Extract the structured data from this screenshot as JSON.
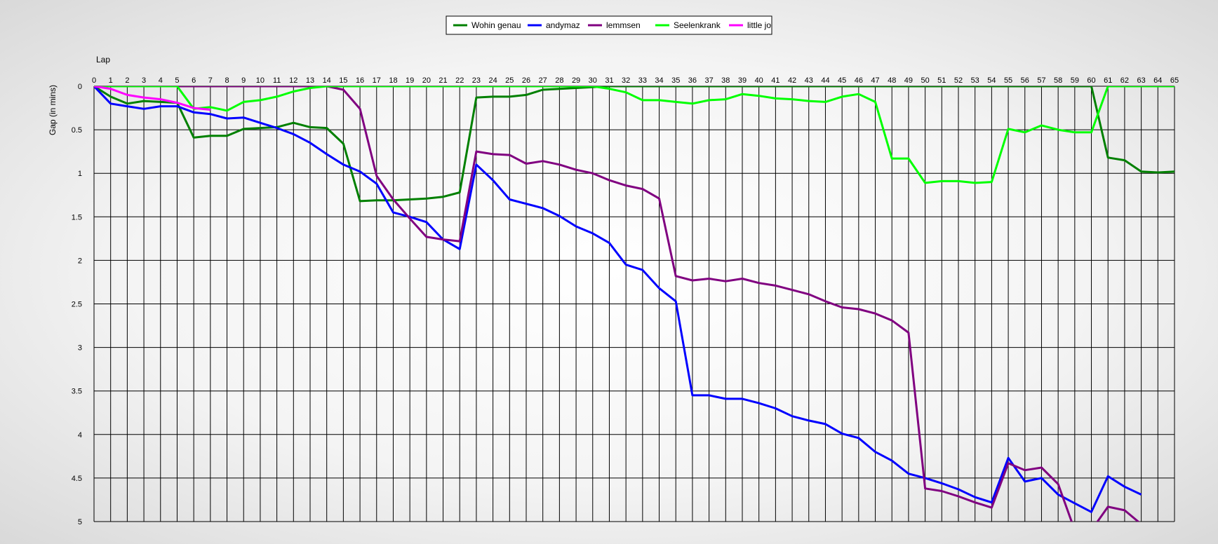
{
  "chart_data": {
    "type": "line",
    "xlabel": "Lap",
    "ylabel": "Gap (in mins)",
    "xlim": [
      0,
      65
    ],
    "ylim": [
      0,
      5
    ],
    "y_reversed": true,
    "x_ticks": [
      0,
      1,
      2,
      3,
      4,
      5,
      6,
      7,
      8,
      9,
      10,
      11,
      12,
      13,
      14,
      15,
      16,
      17,
      18,
      19,
      20,
      21,
      22,
      23,
      24,
      25,
      26,
      27,
      28,
      29,
      30,
      31,
      32,
      33,
      34,
      35,
      36,
      37,
      38,
      39,
      40,
      41,
      42,
      43,
      44,
      45,
      46,
      47,
      48,
      49,
      50,
      51,
      52,
      53,
      54,
      55,
      56,
      57,
      58,
      59,
      60,
      61,
      62,
      63,
      64,
      65
    ],
    "y_ticks": [
      "0",
      "0.5",
      "1",
      "1.5",
      "2",
      "2.5",
      "3",
      "3.5",
      "4",
      "4.5",
      "5"
    ],
    "y_tick_values": [
      0,
      0.5,
      1,
      1.5,
      2,
      2.5,
      3,
      3.5,
      4,
      4.5,
      5
    ],
    "grid": true,
    "legend_position": "top-center",
    "series": [
      {
        "name": "Wohin genau",
        "color": "#008000",
        "x": [
          0,
          1,
          2,
          3,
          4,
          5,
          6,
          7,
          8,
          9,
          10,
          11,
          12,
          13,
          14,
          15,
          16,
          17,
          18,
          19,
          20,
          21,
          22,
          23,
          24,
          25,
          26,
          27,
          28,
          29,
          30,
          31,
          32,
          33,
          34,
          35,
          36,
          37,
          38,
          39,
          40,
          41,
          42,
          43,
          44,
          45,
          46,
          47,
          48,
          49,
          50,
          51,
          52,
          53,
          54,
          55,
          56,
          57,
          58,
          59,
          60,
          61,
          62,
          63,
          64,
          65
        ],
        "y": [
          0,
          0.12,
          0.2,
          0.17,
          0.18,
          0.19,
          0.59,
          0.57,
          0.57,
          0.49,
          0.48,
          0.47,
          0.42,
          0.47,
          0.48,
          0.66,
          1.32,
          1.31,
          1.31,
          1.3,
          1.29,
          1.27,
          1.22,
          0.13,
          0.12,
          0.12,
          0.1,
          0.04,
          0.03,
          0.02,
          0.01,
          0,
          0,
          0,
          0,
          0,
          0,
          0,
          0,
          0,
          0,
          0,
          0,
          0,
          0,
          0,
          0,
          0,
          0,
          0,
          0,
          0,
          0,
          0,
          0,
          0,
          0,
          0,
          0,
          0,
          0,
          0.82,
          0.85,
          0.98,
          0.99,
          0.98
        ]
      },
      {
        "name": "andymaz",
        "color": "#0000ff",
        "x": [
          0,
          1,
          2,
          3,
          4,
          5,
          6,
          7,
          8,
          9,
          10,
          11,
          12,
          13,
          14,
          15,
          16,
          17,
          18,
          19,
          20,
          21,
          22,
          23,
          24,
          25,
          26,
          27,
          28,
          29,
          30,
          31,
          32,
          33,
          34,
          35,
          36,
          37,
          38,
          39,
          40,
          41,
          42,
          43,
          44,
          45,
          46,
          47,
          48,
          49,
          50,
          51,
          52,
          53,
          54,
          55,
          56,
          57,
          58,
          59,
          60,
          61,
          62,
          63
        ],
        "y": [
          0,
          0.2,
          0.23,
          0.26,
          0.23,
          0.23,
          0.3,
          0.32,
          0.37,
          0.36,
          0.42,
          0.48,
          0.55,
          0.65,
          0.78,
          0.9,
          0.98,
          1.12,
          1.45,
          1.5,
          1.56,
          1.76,
          1.87,
          0.9,
          1.08,
          1.3,
          1.35,
          1.4,
          1.49,
          1.61,
          1.69,
          1.8,
          2.05,
          2.11,
          2.32,
          2.47,
          3.55,
          3.55,
          3.59,
          3.59,
          3.64,
          3.7,
          3.79,
          3.84,
          3.88,
          3.99,
          4.04,
          4.2,
          4.3,
          4.45,
          4.5,
          4.56,
          4.63,
          4.72,
          4.78,
          4.27,
          4.54,
          4.5,
          4.69,
          4.79,
          4.89,
          4.48,
          4.6,
          4.69
        ]
      },
      {
        "name": "lemmsen",
        "color": "#800080",
        "x": [
          0,
          1,
          2,
          3,
          4,
          5,
          6,
          7,
          8,
          9,
          10,
          11,
          12,
          13,
          14,
          15,
          16,
          17,
          18,
          19,
          20,
          21,
          22,
          23,
          24,
          25,
          26,
          27,
          28,
          29,
          30,
          31,
          32,
          33,
          34,
          35,
          36,
          37,
          38,
          39,
          40,
          41,
          42,
          43,
          44,
          45,
          46,
          47,
          48,
          49,
          50,
          51,
          52,
          53,
          54,
          55,
          56,
          57,
          58,
          59,
          60,
          61,
          62,
          63
        ],
        "y": [
          0,
          0,
          0,
          0,
          0,
          0,
          0,
          0,
          0,
          0,
          0,
          0,
          0,
          0,
          0,
          0.04,
          0.26,
          1.03,
          1.3,
          1.52,
          1.73,
          1.76,
          1.78,
          0.75,
          0.78,
          0.79,
          0.89,
          0.86,
          0.9,
          0.96,
          1,
          1.08,
          1.14,
          1.18,
          1.29,
          2.18,
          2.23,
          2.21,
          2.24,
          2.21,
          2.26,
          2.29,
          2.34,
          2.39,
          2.47,
          2.54,
          2.56,
          2.61,
          2.69,
          2.83,
          4.62,
          4.65,
          4.71,
          4.78,
          4.84,
          4.33,
          4.41,
          4.38,
          4.57,
          5.1,
          5.1,
          4.83,
          4.87,
          5.03
        ]
      },
      {
        "name": "Seelenkrank",
        "color": "#00ff00",
        "x": [
          0,
          1,
          2,
          3,
          4,
          5,
          6,
          7,
          8,
          9,
          10,
          11,
          12,
          13,
          14,
          15,
          16,
          17,
          18,
          19,
          20,
          21,
          22,
          23,
          24,
          25,
          26,
          27,
          28,
          29,
          30,
          31,
          32,
          33,
          34,
          35,
          36,
          37,
          38,
          39,
          40,
          41,
          42,
          43,
          44,
          45,
          46,
          47,
          48,
          49,
          50,
          51,
          52,
          53,
          54,
          55,
          56,
          57,
          58,
          59,
          60,
          61,
          62,
          63,
          64,
          65
        ],
        "y": [
          0,
          0,
          0,
          0,
          0,
          0,
          0.26,
          0.24,
          0.28,
          0.18,
          0.16,
          0.12,
          0.06,
          0.02,
          0,
          0,
          0,
          0,
          0,
          0,
          0,
          0,
          0,
          0,
          0,
          0,
          0,
          0,
          0,
          0,
          0,
          0.03,
          0.07,
          0.16,
          0.16,
          0.18,
          0.2,
          0.16,
          0.15,
          0.09,
          0.11,
          0.14,
          0.15,
          0.17,
          0.18,
          0.12,
          0.09,
          0.18,
          0.83,
          0.83,
          1.11,
          1.09,
          1.09,
          1.11,
          1.1,
          0.49,
          0.53,
          0.45,
          0.5,
          0.53,
          0.53,
          0,
          0,
          0,
          0,
          0
        ]
      },
      {
        "name": "little jo",
        "color": "#ff00ff",
        "x": [
          0,
          1,
          2,
          3,
          4,
          5,
          6,
          7
        ],
        "y": [
          0,
          0.03,
          0.1,
          0.13,
          0.15,
          0.19,
          0.25,
          0.27
        ]
      }
    ]
  }
}
